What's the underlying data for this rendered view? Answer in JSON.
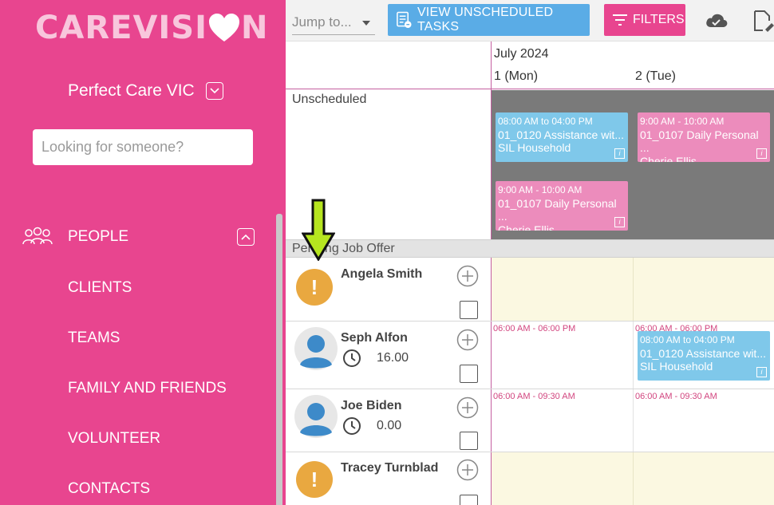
{
  "sidebar": {
    "logo_left": "CAREVISI",
    "logo_right": "N",
    "org_name": "Perfect Care VIC",
    "search_placeholder": "Looking for someone?",
    "people_label": "PEOPLE",
    "items": [
      {
        "label": "CLIENTS"
      },
      {
        "label": "TEAMS"
      },
      {
        "label": "FAMILY AND FRIENDS"
      },
      {
        "label": "VOLUNTEER"
      },
      {
        "label": "CONTACTS"
      }
    ]
  },
  "topbar": {
    "jump_placeholder": "Jump to...",
    "unscheduled_button": "VIEW UNSCHEDULED TASKS",
    "filters_button": "FILTERS"
  },
  "calendar": {
    "month": "July 2024",
    "days": [
      "1 (Mon)",
      "2 (Tue)"
    ],
    "unscheduled_label": "Unscheduled",
    "unscheduled_shifts": [
      {
        "time": "08:00 AM to 04:00 PM",
        "title": "01_0120 Assistance wit...",
        "client": "SIL Household",
        "color": "#7fc8ea"
      },
      {
        "time": "9:00 AM - 10:00 AM",
        "title": "01_0107 Daily Personal ...",
        "client": "Cherie Ellis",
        "color": "#ec8cbc"
      },
      {
        "time": "9:00 AM - 10:00 AM",
        "title": "01_0107 Daily Personal ...",
        "client": "Cherie Ellis",
        "color": "#ec8cbc"
      }
    ],
    "pending_label": "Pending Job Offer",
    "staff": [
      {
        "name": "Angela Smith",
        "status": "warning",
        "hours": "",
        "availability": [
          "",
          ""
        ]
      },
      {
        "name": "Seph Alfon",
        "status": "avatar",
        "hours": "16.00",
        "availability": [
          "06:00 AM - 06:00 PM",
          "06:00 AM - 06:00 PM"
        ],
        "shift": {
          "time": "08:00 AM to 04:00 PM",
          "title": "01_0120 Assistance wit...",
          "client": "SIL Household"
        }
      },
      {
        "name": "Joe Biden",
        "status": "avatar",
        "hours": "0.00",
        "availability": [
          "06:00 AM - 09:30 AM",
          "06:00 AM - 09:30 AM"
        ]
      },
      {
        "name": "Tracey Turnblad",
        "status": "warning",
        "hours": "",
        "availability": [
          "",
          ""
        ]
      }
    ],
    "warning_glyph": "!",
    "info_glyph": "i"
  },
  "colors": {
    "sidebar_bg": "#e8458f",
    "unscheduled_button": "#5aace6",
    "filters_button": "#e8458f",
    "shift_blue": "#7fc8ea",
    "shift_pink": "#ec8cbc",
    "unavailable_cell": "#fbf8e1",
    "warning": "#e9a840",
    "annotation_arrow": "#b6e51f"
  }
}
